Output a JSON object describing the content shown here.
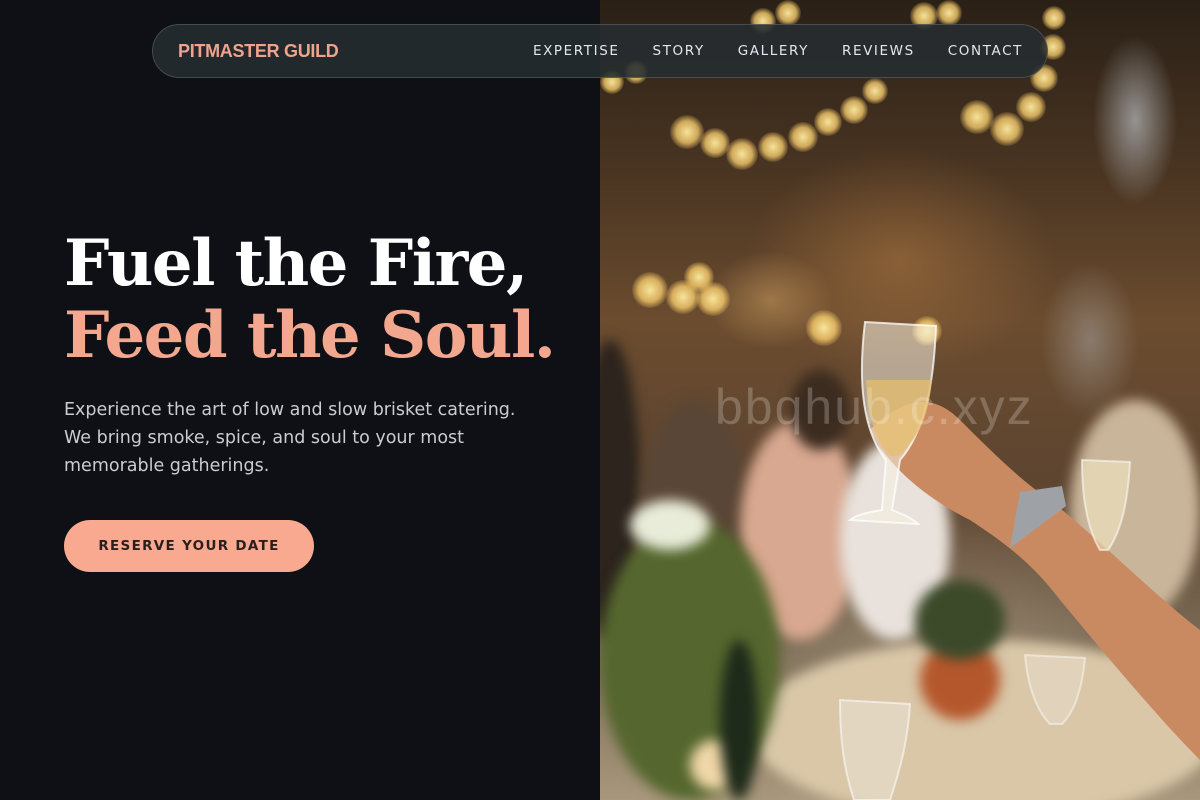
{
  "brand": {
    "name": "PITMASTER GUILD"
  },
  "nav": {
    "links": [
      "EXPERTISE",
      "STORY",
      "GALLERY",
      "REVIEWS",
      "CONTACT"
    ]
  },
  "hero": {
    "headline_line1": "Fuel the Fire,",
    "headline_line2": "Feed the Soul.",
    "description": "Experience the art of low and slow brisket catering. We bring smoke, spice, and soul to your most memorable gatherings.",
    "cta_label": "RESERVE YOUR DATE",
    "image_alt": "Guests raising champagne glasses at a banquet table under string lights"
  },
  "watermark": {
    "text": "bbqhub.c.xyz"
  },
  "colors": {
    "background": "#0e1015",
    "accent": "#f4a78f",
    "cta_bg": "#f8a98f",
    "nav_bg": "#262c30",
    "text_muted": "#c9ccd2"
  }
}
